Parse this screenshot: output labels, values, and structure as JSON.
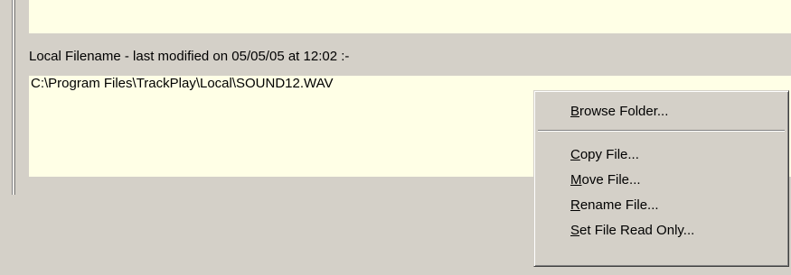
{
  "panel": {
    "section_label": "Local Filename - last modified on 05/05/05 at 12:02 :-",
    "file_path": "C:\\Program Files\\TrackPlay\\Local\\SOUND12.WAV"
  },
  "context_menu": {
    "items": [
      {
        "key": "B",
        "rest": "rowse Folder..."
      },
      {
        "key": "C",
        "rest": "opy File..."
      },
      {
        "key": "M",
        "rest": "ove File..."
      },
      {
        "key": "R",
        "rest": "ename File..."
      },
      {
        "key": "S",
        "rest": "et File Read Only..."
      }
    ]
  }
}
